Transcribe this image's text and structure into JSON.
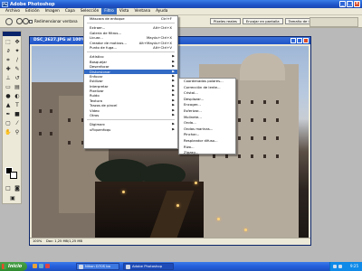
{
  "app": {
    "title": "Adobe Photoshop"
  },
  "menubar": [
    {
      "label": "Archivo"
    },
    {
      "label": "Edición"
    },
    {
      "label": "Imagen"
    },
    {
      "label": "Capa"
    },
    {
      "label": "Selección"
    },
    {
      "label": "Filtro",
      "active": true
    },
    {
      "label": "Vista"
    },
    {
      "label": "Ventana"
    },
    {
      "label": "Ayuda"
    }
  ],
  "options_bar": {
    "checkbox_label": "Redimensionar ventana",
    "buttons": [
      {
        "label": "Píxeles reales"
      },
      {
        "label": "Encajar en pantalla"
      },
      {
        "label": "Tamaño de impresión"
      }
    ]
  },
  "document": {
    "title": "DSC_2627.JPG al 100%",
    "status": "Doc: 1,25 MB/1,25 MB",
    "zoom": "100%"
  },
  "filter_menu": {
    "items": [
      {
        "label": "Máscara de enfoque",
        "shortcut": "Ctrl+F"
      },
      {
        "sep": true
      },
      {
        "label": "Extraer...",
        "shortcut": "Alt+Ctrl+X"
      },
      {
        "label": "Galería de filtros..."
      },
      {
        "label": "Licuar...",
        "shortcut": "Mayús+Ctrl+X"
      },
      {
        "label": "Creador de motivos...",
        "shortcut": "Alt+Mayús+Ctrl+X"
      },
      {
        "label": "Punto de fuga...",
        "shortcut": "Alt+Ctrl+V"
      },
      {
        "sep": true
      },
      {
        "label": "Artístico",
        "sub": true
      },
      {
        "label": "Bosquejar",
        "sub": true
      },
      {
        "label": "Desenfocar",
        "sub": true
      },
      {
        "label": "Distorsionar",
        "sub": true,
        "highlight": true
      },
      {
        "label": "Enfocar",
        "sub": true
      },
      {
        "label": "Estilizar",
        "sub": true
      },
      {
        "label": "Interpretar",
        "sub": true
      },
      {
        "label": "Pixelizar",
        "sub": true
      },
      {
        "label": "Ruido",
        "sub": true
      },
      {
        "label": "Textura",
        "sub": true
      },
      {
        "label": "Trazos de pincel",
        "sub": true
      },
      {
        "label": "Vídeo",
        "sub": true
      },
      {
        "label": "Otros",
        "sub": true
      },
      {
        "sep": true
      },
      {
        "label": "Digimarc",
        "sub": true
      },
      {
        "label": "uFiquenfoqu",
        "sub": true
      }
    ]
  },
  "distort_submenu": {
    "items": [
      {
        "label": "Coordenadas polares..."
      },
      {
        "label": "Corrección de lente..."
      },
      {
        "label": "Cristal..."
      },
      {
        "label": "Desplazar..."
      },
      {
        "label": "Encoger..."
      },
      {
        "label": "Esferizar..."
      },
      {
        "label": "Molinete..."
      },
      {
        "label": "Onda..."
      },
      {
        "label": "Ondas marinas..."
      },
      {
        "label": "Pinchar..."
      },
      {
        "label": "Resplandor difuso..."
      },
      {
        "label": "Rizo..."
      },
      {
        "label": "Zigzag..."
      }
    ]
  },
  "taskbar": {
    "start_label": "Inicio",
    "tasks": [
      {
        "label": "Nikon D70S bo",
        "active": false
      },
      {
        "label": "Adobe Photoshop",
        "active": true
      }
    ],
    "clock": "9:25"
  },
  "colors": {
    "menu_highlight": "#316ac5",
    "title_blue": "#245edb",
    "start_green": "#3a9a3a"
  }
}
